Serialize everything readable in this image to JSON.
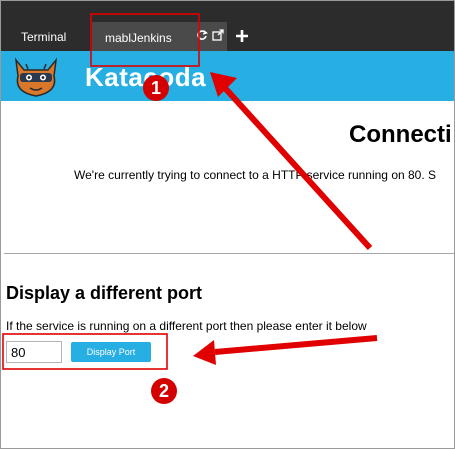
{
  "tabs": {
    "terminal": "Terminal",
    "active": "mablJenkins",
    "icons": [
      "refresh-icon",
      "external-link-icon",
      "add-tab-icon"
    ]
  },
  "brand": {
    "name": "Katacoda",
    "accent": "#27aee3"
  },
  "main": {
    "title": "Connecti",
    "message": "We're currently trying to connect to a HTTP service running on 80. S",
    "port_heading": "Display a different port",
    "port_help": "If the service is running on a different port then please enter it below",
    "port_value": "80",
    "port_button": "Display Port"
  },
  "annotations": {
    "badge_1": "1",
    "badge_2": "2",
    "color": "#e00000"
  }
}
